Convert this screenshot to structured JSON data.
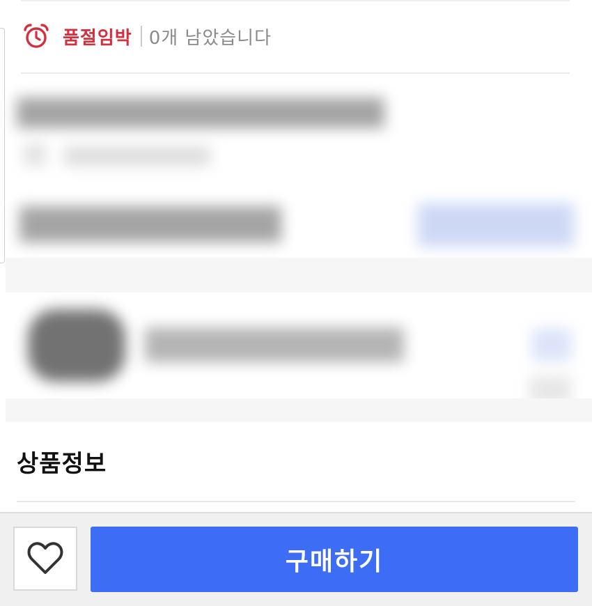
{
  "stock_notice": {
    "label": "품절임박",
    "remaining_text": "0개 남았습니다"
  },
  "section": {
    "title": "상품정보"
  },
  "bottom_bar": {
    "buy_label": "구매하기"
  },
  "icons": {
    "stock": "alarm-clock-icon",
    "wishlist": "heart-outline-icon"
  },
  "colors": {
    "stock_red": "#d32f3f",
    "buy_blue": "#3d6df4"
  }
}
